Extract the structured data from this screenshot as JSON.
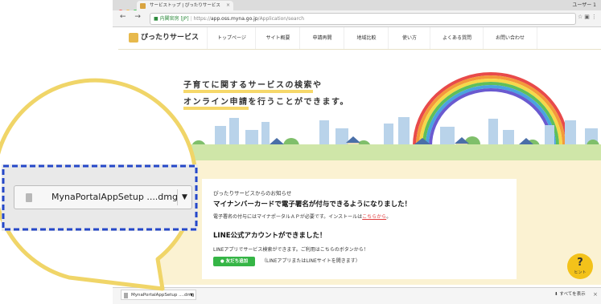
{
  "browser": {
    "tab_title": "サービストップ | ぴったりサービス",
    "user_label": "ユーザー 1",
    "url_secure_label": "内閣官房 [JP]",
    "url_scheme": "https://",
    "url_host": "app.oss.myna.go.jp",
    "url_path": "/Application/search",
    "nav_glyphs": "← → C"
  },
  "site": {
    "logo_text": "ぴったりサービス",
    "nav": [
      "トップページ",
      "サイト概要",
      "申請再開",
      "地域比較",
      "使い方",
      "よくある質問",
      "お問い合わせ"
    ]
  },
  "hero": {
    "slogan_line1_highlight": "子育てに関するサービスの検索",
    "slogan_line1_rest": "や",
    "slogan_line2_highlight": "オンライン申請",
    "slogan_line2_rest": "を行うことができます。"
  },
  "notice": {
    "heading": "ぴったりサービスからのお知らせ",
    "title": "マイナンバーカードで電子署名が付与できるようになりました！",
    "body": "電子署名の付与にはマイナポータルＡＰが必要です。インストールは",
    "link": "こちらから",
    "body_end": "。",
    "line_title": "LINE公式アカウントができました！",
    "line_body": "LINEアプリでサービス検索ができます。ご利用はこちらのボタンから！",
    "line_button": "友だち追加",
    "line_note": "（LINEアプリまたはLINEサイトを開きます）"
  },
  "hint": {
    "symbol": "?",
    "label": "ヒント"
  },
  "download": {
    "filename": "MynaPortalAppSetup ....dmg",
    "show_all": "すべてを表示",
    "close": "×"
  },
  "colors": {
    "accent_yellow": "#f3c21a",
    "callout_border": "#f0d568",
    "dashed_highlight": "#2548c9",
    "line_green": "#35b546",
    "link_red": "#e03b3b"
  }
}
